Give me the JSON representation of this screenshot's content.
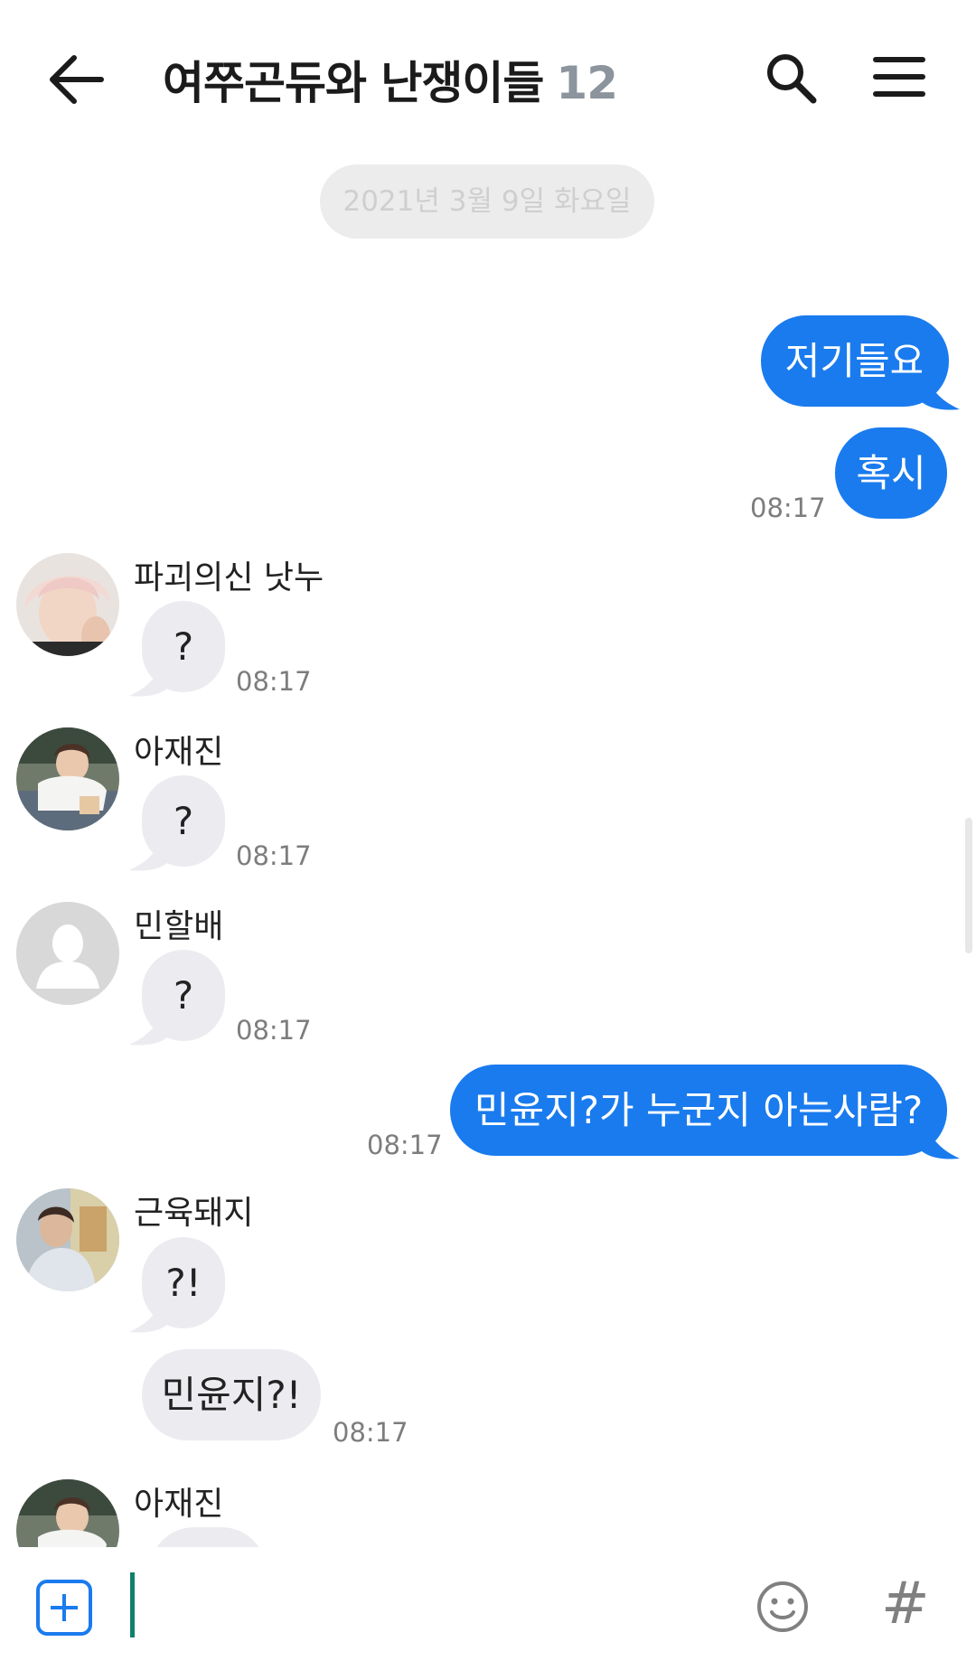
{
  "header": {
    "title": "여쭈곤듀와 난쟁이들",
    "member_count": "12",
    "back_icon": "arrow-left-icon",
    "search_icon": "search-icon",
    "menu_icon": "hamburger-menu-icon"
  },
  "date_divider": "2021년 3월 9일 화요일",
  "colors": {
    "my_bubble": "#1a7bee",
    "other_bubble": "#ececf0",
    "date_pill": "#ececec",
    "cursor": "#11806a"
  },
  "messages": [
    {
      "sender": "me",
      "text": "저기들요"
    },
    {
      "sender": "me",
      "text": "혹시",
      "time": "08:17"
    },
    {
      "sender": "파괴의신 낫누",
      "text": "?",
      "time": "08:17"
    },
    {
      "sender": "아재진",
      "text": "?",
      "time": "08:17"
    },
    {
      "sender": "민할배",
      "text": "?",
      "time": "08:17"
    },
    {
      "sender": "me",
      "text": "민윤지?가 누군지 아는사람?",
      "time": "08:17"
    },
    {
      "sender": "근육돼지",
      "text": "?!"
    },
    {
      "sender": "근육돼지",
      "text": "민윤지?!",
      "time": "08:17"
    },
    {
      "sender": "아재진",
      "text": ""
    }
  ],
  "input_bar": {
    "add_icon": "plus-square-icon",
    "emoji_icon": "smiley-icon",
    "hash_label": "#",
    "message_value": ""
  }
}
